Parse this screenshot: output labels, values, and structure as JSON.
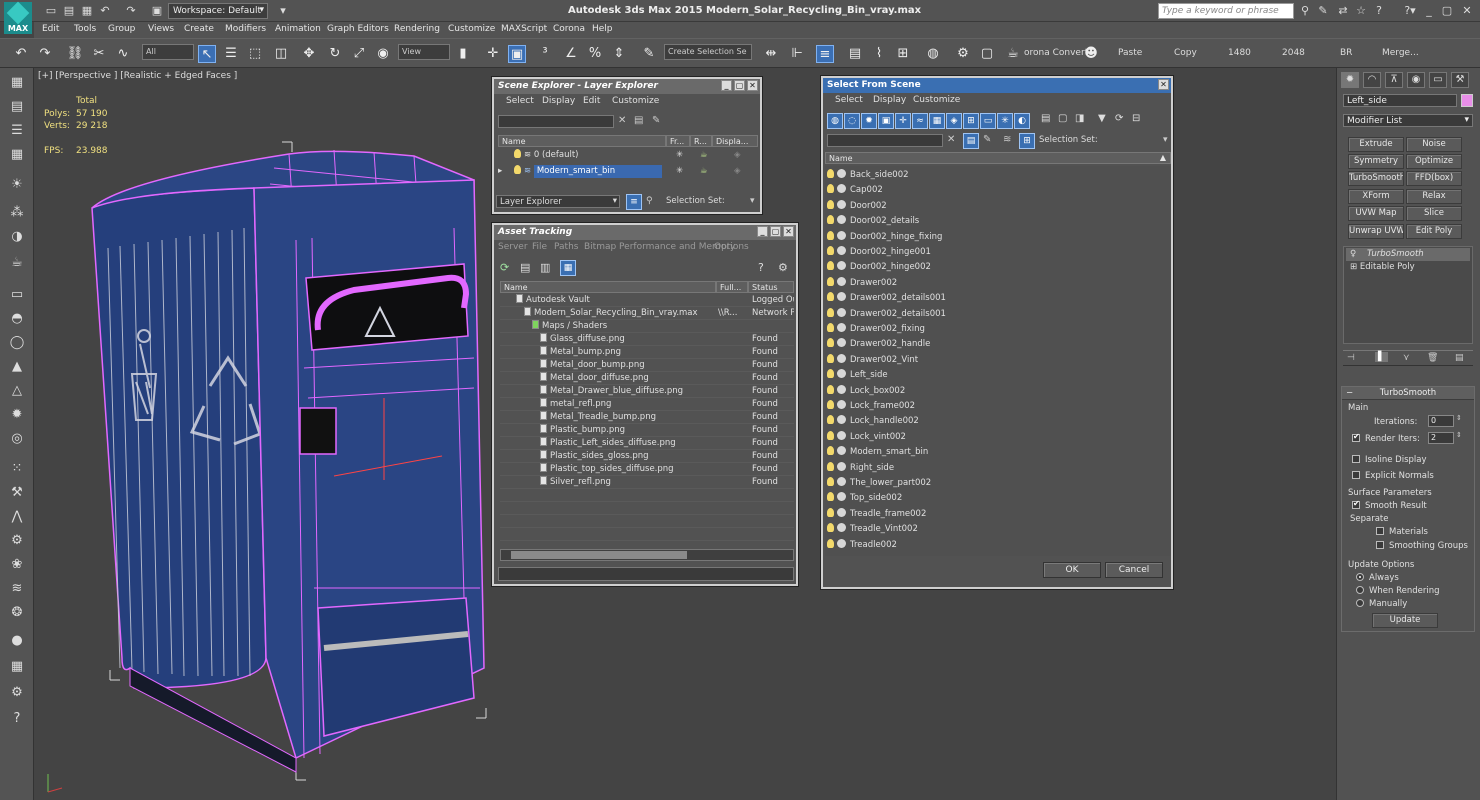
{
  "app": {
    "logo_text": "MAX",
    "workspace": "Workspace: Default",
    "title": "Autodesk 3ds Max  2015     Modern_Solar_Recycling_Bin_vray.max",
    "search_placeholder": "Type a keyword or phrase"
  },
  "menu": [
    "Edit",
    "Tools",
    "Group",
    "Views",
    "Create",
    "Modifiers",
    "Animation",
    "Graph Editors",
    "Rendering",
    "Customize",
    "MAXScript",
    "Corona",
    "Help"
  ],
  "toolbar": {
    "filter_select": "All",
    "ref_coord": "View",
    "selection_set": "Create Selection Se",
    "corona_convert": "orona Convert",
    "paste": "Paste",
    "copy": "Copy",
    "width_val": "1480",
    "height_val": "2048",
    "br": "BR",
    "merge": "Merge..."
  },
  "viewport": {
    "label": "[+] [Perspective ] [Realistic + Edged Faces ]",
    "stats": {
      "total_label": "Total",
      "polys_label": "Polys:",
      "polys_val": "57 190",
      "verts_label": "Verts:",
      "verts_val": "29 218",
      "fps_label": "FPS:",
      "fps_val": "23.988"
    }
  },
  "scene_explorer": {
    "title": "Scene Explorer - Layer Explorer",
    "menu": [
      "Select",
      "Display",
      "Edit",
      "Customize"
    ],
    "columns": [
      "Name",
      "Fr...",
      "R...",
      "Displa..."
    ],
    "rows": [
      {
        "name": "0 (default)",
        "selected": false
      },
      {
        "name": "Modern_smart_bin",
        "selected": true
      }
    ],
    "footer_select": "Layer Explorer",
    "selection_set_label": "Selection Set:"
  },
  "asset_tracking": {
    "title": "Asset Tracking",
    "menu": [
      "Server",
      "File",
      "Paths",
      "Bitmap Performance and Memory",
      "Options"
    ],
    "columns": [
      "Name",
      "Full...",
      "Status"
    ],
    "rows": [
      {
        "name": "Autodesk Vault",
        "full": "",
        "status": "Logged Out",
        "indent": 2
      },
      {
        "name": "Modern_Solar_Recycling_Bin_vray.max",
        "full": "\\\\R...",
        "status": "Network Pa",
        "indent": 3
      },
      {
        "name": "Maps / Shaders",
        "full": "",
        "status": "",
        "indent": 4
      },
      {
        "name": "Glass_diffuse.png",
        "full": "",
        "status": "Found",
        "indent": 5
      },
      {
        "name": "Metal_bump.png",
        "full": "",
        "status": "Found",
        "indent": 5
      },
      {
        "name": "Metal_door_bump.png",
        "full": "",
        "status": "Found",
        "indent": 5
      },
      {
        "name": "Metal_door_diffuse.png",
        "full": "",
        "status": "Found",
        "indent": 5
      },
      {
        "name": "Metal_Drawer_blue_diffuse.png",
        "full": "",
        "status": "Found",
        "indent": 5
      },
      {
        "name": "metal_refl.png",
        "full": "",
        "status": "Found",
        "indent": 5
      },
      {
        "name": "Metal_Treadle_bump.png",
        "full": "",
        "status": "Found",
        "indent": 5
      },
      {
        "name": "Plastic_bump.png",
        "full": "",
        "status": "Found",
        "indent": 5
      },
      {
        "name": "Plastic_Left_sides_diffuse.png",
        "full": "",
        "status": "Found",
        "indent": 5
      },
      {
        "name": "Plastic_sides_gloss.png",
        "full": "",
        "status": "Found",
        "indent": 5
      },
      {
        "name": "Plastic_top_sides_diffuse.png",
        "full": "",
        "status": "Found",
        "indent": 5
      },
      {
        "name": "Silver_refl.png",
        "full": "",
        "status": "Found",
        "indent": 5
      }
    ]
  },
  "select_from_scene": {
    "title": "Select From Scene",
    "menu": [
      "Select",
      "Display",
      "Customize"
    ],
    "selection_set_label": "Selection Set:",
    "column": "Name",
    "items": [
      "Back_side002",
      "Cap002",
      "Door002",
      "Door002_details",
      "Door002_hinge_fixing",
      "Door002_hinge001",
      "Door002_hinge002",
      "Drawer002",
      "Drawer002_details001",
      "Drawer002_details001",
      "Drawer002_fixing",
      "Drawer002_handle",
      "Drawer002_Vint",
      "Left_side",
      "Lock_box002",
      "Lock_frame002",
      "Lock_handle002",
      "Lock_vint002",
      "Modern_smart_bin",
      "Right_side",
      "The_lower_part002",
      "Top_side002",
      "Treadle_frame002",
      "Treadle_Vint002",
      "Treadle002"
    ],
    "ok": "OK",
    "cancel": "Cancel"
  },
  "command_panel": {
    "object_name": "Left_side",
    "modifier_list": "Modifier List",
    "buttons": [
      "Extrude",
      "Noise",
      "Symmetry",
      "Optimize",
      "TurboSmooth",
      "FFD(box)",
      "XForm",
      "Relax",
      "UVW Map",
      "Slice",
      "Unwrap UVW",
      "Edit Poly"
    ],
    "stack": [
      {
        "name": "TurboSmooth",
        "selected": true
      },
      {
        "name": "Editable Poly",
        "selected": false
      }
    ],
    "rollout_title": "TurboSmooth",
    "main_label": "Main",
    "iterations_label": "Iterations:",
    "iterations_val": "0",
    "render_iters_label": "Render Iters:",
    "render_iters_val": "2",
    "isoline_label": "Isoline Display",
    "explicit_normals_label": "Explicit Normals",
    "surface_params_label": "Surface Parameters",
    "smooth_result_label": "Smooth Result",
    "separate_label": "Separate",
    "materials_label": "Materials",
    "smoothing_groups_label": "Smoothing Groups",
    "update_options_label": "Update Options",
    "always_label": "Always",
    "when_rendering_label": "When Rendering",
    "manually_label": "Manually",
    "update_button": "Update"
  },
  "colors": {
    "selection_blue": "#3a69b0",
    "wire_magenta": "#e060ff",
    "bin_blue": "#243e78",
    "bg_gray": "#444444"
  }
}
